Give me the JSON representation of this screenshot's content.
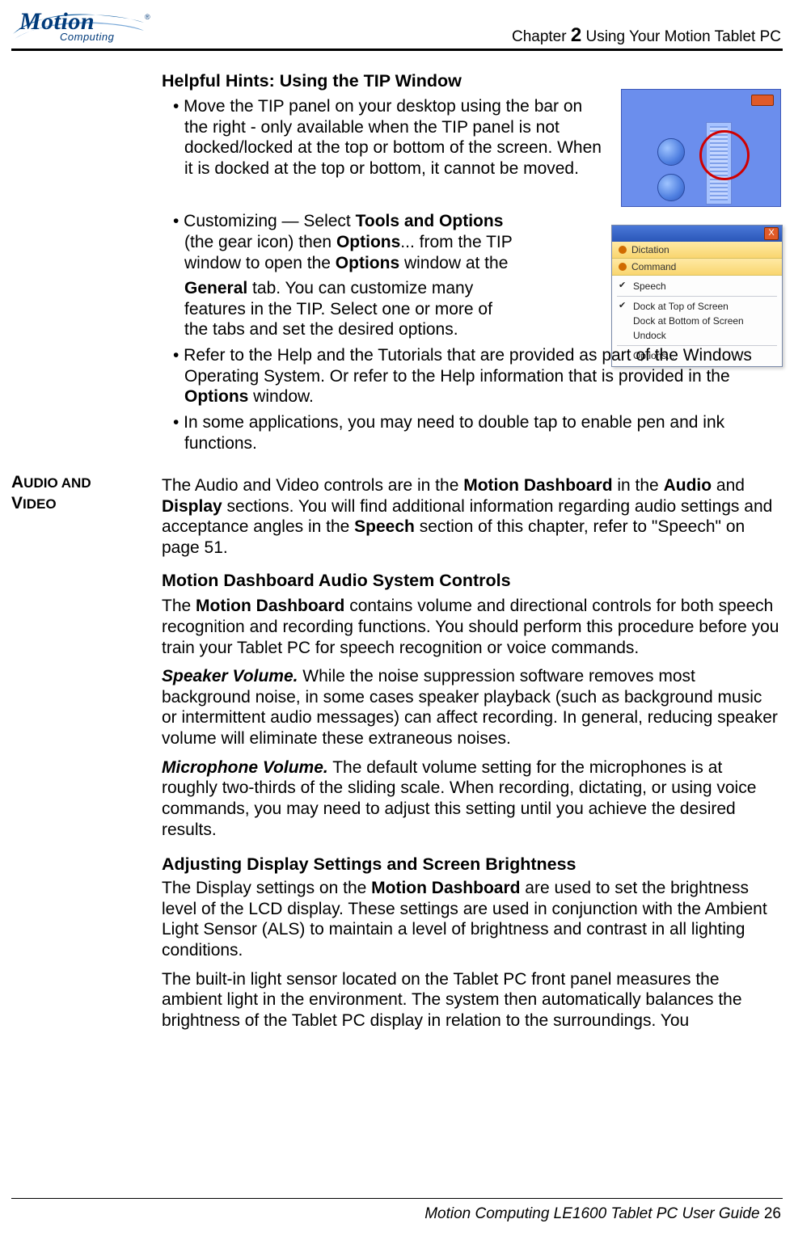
{
  "header": {
    "logo_main": "Motion",
    "logo_sub": "Computing",
    "logo_reg": "®",
    "chapter_prefix": "Chapter ",
    "chapter_num": "2",
    "chapter_title": "  Using Your Motion Tablet PC"
  },
  "sec1": {
    "title": "Helpful Hints: Using the TIP Window",
    "b1": "• Move the TIP panel on your desktop using the bar on the right - only available when the TIP panel is not docked/locked at the top or bottom of the screen. When it is docked at the top or bottom, it cannot be moved.",
    "b2_pre": "• Customizing — Select ",
    "b2_bold1": "Tools and Options",
    "b2_mid1": " (the gear icon) then ",
    "b2_bold2": "Options",
    "b2_mid2": "... from the TIP window to open the ",
    "b2_bold3": "Options",
    "b2_mid3": " window at the",
    "b2_line2_bold": "General",
    "b2_line2_rest": " tab. You can customize many features in the TIP. Select one or more of the tabs and set the desired options.",
    "b3_pre": "• Refer to the Help and the Tutorials that are provided as part of the Windows Operating System. Or refer to the Help information that is provided in the ",
    "b3_bold": "Options",
    "b3_post": " window.",
    "b4": "• In some applications, you may need to double tap to enable pen and ink functions."
  },
  "left_label": "AUDIO AND VIDEO",
  "av": {
    "p1_pre": "The Audio and Video controls are in the ",
    "p1_b1": "Motion Dashboard",
    "p1_mid1": " in the ",
    "p1_b2": "Audio",
    "p1_mid2": " and ",
    "p1_b3": "Display",
    "p1_mid3": " sections. You will find additional information regarding audio settings and acceptance angles in the ",
    "p1_b4": "Speech",
    "p1_post": " section of this chapter, refer to \"Speech\" on page 51.",
    "h2": "Motion Dashboard Audio System Controls",
    "p2_pre": "The ",
    "p2_b1": "Motion Dashboard",
    "p2_post": " contains volume and directional controls for both speech recognition and recording functions. You should perform this procedure before you train your Tablet PC for speech recognition or voice commands.",
    "p3_em": "Speaker Volume.",
    "p3_body": " While the noise suppression software removes most background noise, in some cases speaker playback (such as background music or intermittent audio messages) can affect recording. In general, reducing speaker volume will eliminate these extraneous noises.",
    "p4_em": "Microphone Volume.",
    "p4_body": " The default volume setting for the microphones is at roughly two-thirds of the sliding scale. When recording, dictating, or using voice commands, you may need to adjust this setting until you achieve the desired results.",
    "h3": "Adjusting Display Settings and Screen Brightness",
    "p5_pre": "The Display settings on the ",
    "p5_b1": "Motion Dashboard",
    "p5_post": " are used to set the brightness level of the LCD display. These settings are used in conjunction with the Ambient Light Sensor (ALS) to maintain a level of brightness and contrast in all lighting conditions.",
    "p6": "The built-in light sensor located on the Tablet PC front panel measures the ambient light in the environment. The system then automatically balances the brightness of the Tablet PC display in relation to the surroundings. You"
  },
  "fig2_menu": {
    "x": "X",
    "dictation": "Dictation",
    "command": "Command",
    "speech": "Speech",
    "docktop": "Dock at Top of Screen",
    "dockbottom": "Dock at Bottom of Screen",
    "undock": "Undock",
    "options": "Options..."
  },
  "footer": {
    "text": "Motion Computing LE1600 Tablet PC User Guide ",
    "page": "26"
  }
}
